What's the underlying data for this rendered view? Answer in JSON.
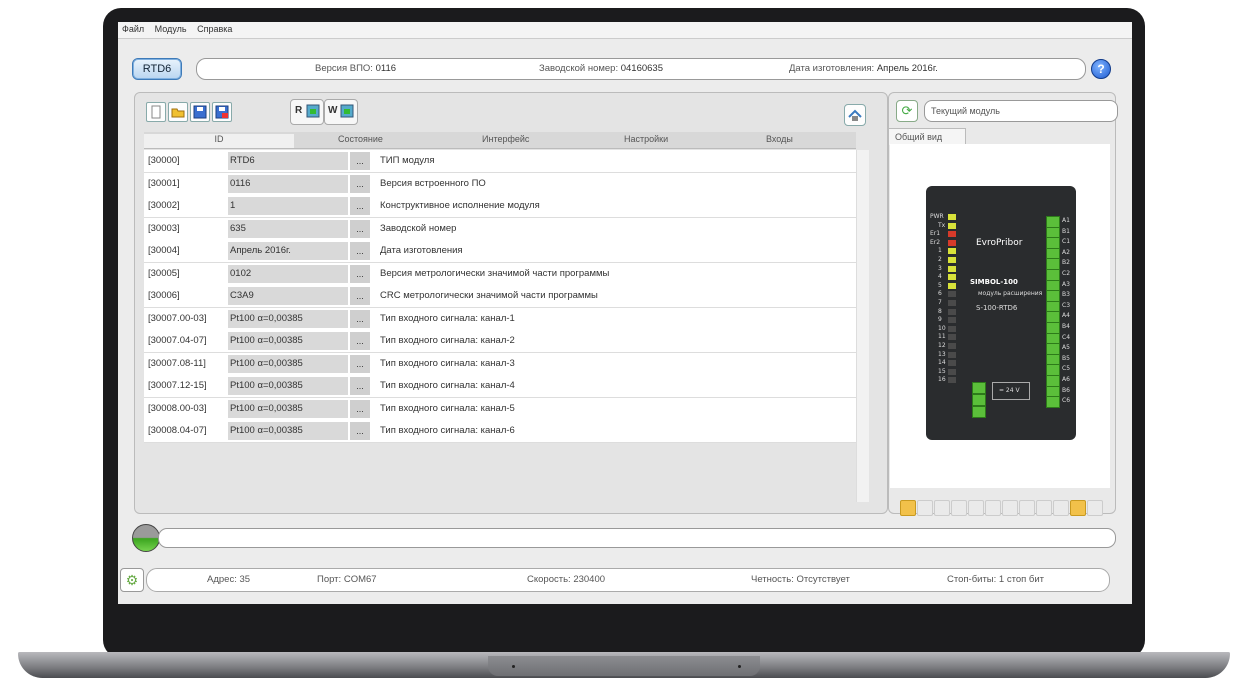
{
  "menu": [
    "Файл",
    "Модуль",
    "Справка"
  ],
  "header": {
    "module": "RTD6",
    "fw_label": "Версия ВПО:",
    "fw_value": "0116",
    "serial_label": "Заводской номер:",
    "serial_value": "04160635",
    "date_label": "Дата изготовления:",
    "date_value": "Апрель 2016г.",
    "help": "?"
  },
  "toolbar": {
    "r_label": "R",
    "w_label": "W"
  },
  "tabs": [
    "ID",
    "Состояние",
    "Интерфейс",
    "Настройки",
    "Входы"
  ],
  "rows": [
    {
      "addr": "[30000]",
      "value": "RTD6",
      "desc": "ТИП модуля"
    },
    {
      "addr": "[30001]",
      "value": "0116",
      "desc": "Версия встроенного ПО"
    },
    {
      "addr": "[30002]",
      "value": "1",
      "desc": "Конструктивное исполнение модуля"
    },
    {
      "addr": "[30003]",
      "value": "635",
      "desc": "Заводской номер"
    },
    {
      "addr": "[30004]",
      "value": "Апрель 2016г.",
      "desc": "Дата изготовления"
    },
    {
      "addr": "[30005]",
      "value": "0102",
      "desc": "Версия метрологически значимой части программы"
    },
    {
      "addr": "[30006]",
      "value": "C3A9",
      "desc": "CRC метрологически значимой части программы"
    },
    {
      "addr": "[30007.00-03]",
      "value": "Pt100 α=0,00385",
      "desc": "Тип входного сигнала: канал-1"
    },
    {
      "addr": "[30007.04-07]",
      "value": "Pt100 α=0,00385",
      "desc": "Тип входного сигнала: канал-2"
    },
    {
      "addr": "[30007.08-11]",
      "value": "Pt100 α=0,00385",
      "desc": "Тип входного сигнала: канал-3"
    },
    {
      "addr": "[30007.12-15]",
      "value": "Pt100 α=0,00385",
      "desc": "Тип входного сигнала: канал-4"
    },
    {
      "addr": "[30008.00-03]",
      "value": "Pt100 α=0,00385",
      "desc": "Тип входного сигнала: канал-5"
    },
    {
      "addr": "[30008.04-07]",
      "value": "Pt100 α=0,00385",
      "desc": "Тип входного сигнала: канал-6"
    }
  ],
  "ellipsis": "...",
  "right": {
    "current_module": "Текущий модуль",
    "view_tab": "Общий вид"
  },
  "device": {
    "brand": "EvroPribor",
    "model": "SIMBOL-100",
    "subtitle": "модуль расширения",
    "code": "S-100-RTD6",
    "power": "= 24 V",
    "leds_left": [
      "PWR",
      "Tx",
      "Er1",
      "Er2",
      "1",
      "2",
      "3",
      "4",
      "5",
      "6",
      "7",
      "8",
      "9",
      "10",
      "11",
      "12",
      "13",
      "14",
      "15",
      "16"
    ],
    "terms_right": [
      "A1",
      "B1",
      "C1",
      "A2",
      "B2",
      "C2",
      "A3",
      "B3",
      "C3",
      "A4",
      "B4",
      "C4",
      "A5",
      "B5",
      "C5",
      "A6",
      "B6",
      "C6"
    ]
  },
  "status": {
    "addr_label": "Адрес:",
    "addr_value": "35",
    "port_label": "Порт:",
    "port_value": "COM67",
    "speed_label": "Скорость:",
    "speed_value": "230400",
    "parity_label": "Четность:",
    "parity_value": "Отсутствует",
    "stop_label": "Стоп-биты:",
    "stop_value": "1 стоп бит"
  },
  "colors": {
    "accent": "#3e7ab8",
    "led_green": "#5bbf3a",
    "led_yellow": "#d8e23a",
    "led_red": "#d63a2a"
  }
}
